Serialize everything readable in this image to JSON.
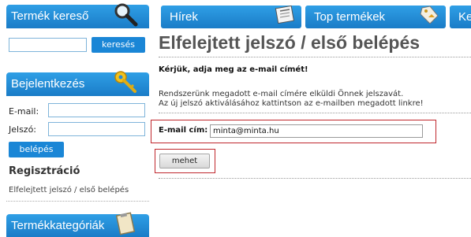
{
  "sidebar": {
    "search": {
      "header": "Termék kereső",
      "button": "keresés"
    },
    "login": {
      "header": "Bejelentkezés",
      "email_label": "E-mail:",
      "password_label": "Jelszó:",
      "button": "belépés"
    },
    "registration": "Regisztráció",
    "forgot_link": "Elfelejtett jelszó / első belépés",
    "categories": {
      "header": "Termékkategóriák"
    }
  },
  "nav": {
    "tabs": [
      {
        "label": "Hírek"
      },
      {
        "label": "Top termékek"
      },
      {
        "label": "Ke"
      }
    ]
  },
  "main": {
    "title": "Elfelejtett jelszó / első belépés",
    "request": "Kérjük, adja meg az e-mail címét!",
    "info_line1": "Rendszerünk megadott e-mail címére elküldi Önnek jelszavát.",
    "info_line2": "Az új jelszó aktiválásához kattintson az e-mailben megadott linkre!",
    "email_label": "E-mail cím:",
    "email_value": "minta@minta.hu",
    "submit": "mehet"
  },
  "colors": {
    "accent_blue": "#1a86d6",
    "highlight_red": "#c0272d"
  }
}
